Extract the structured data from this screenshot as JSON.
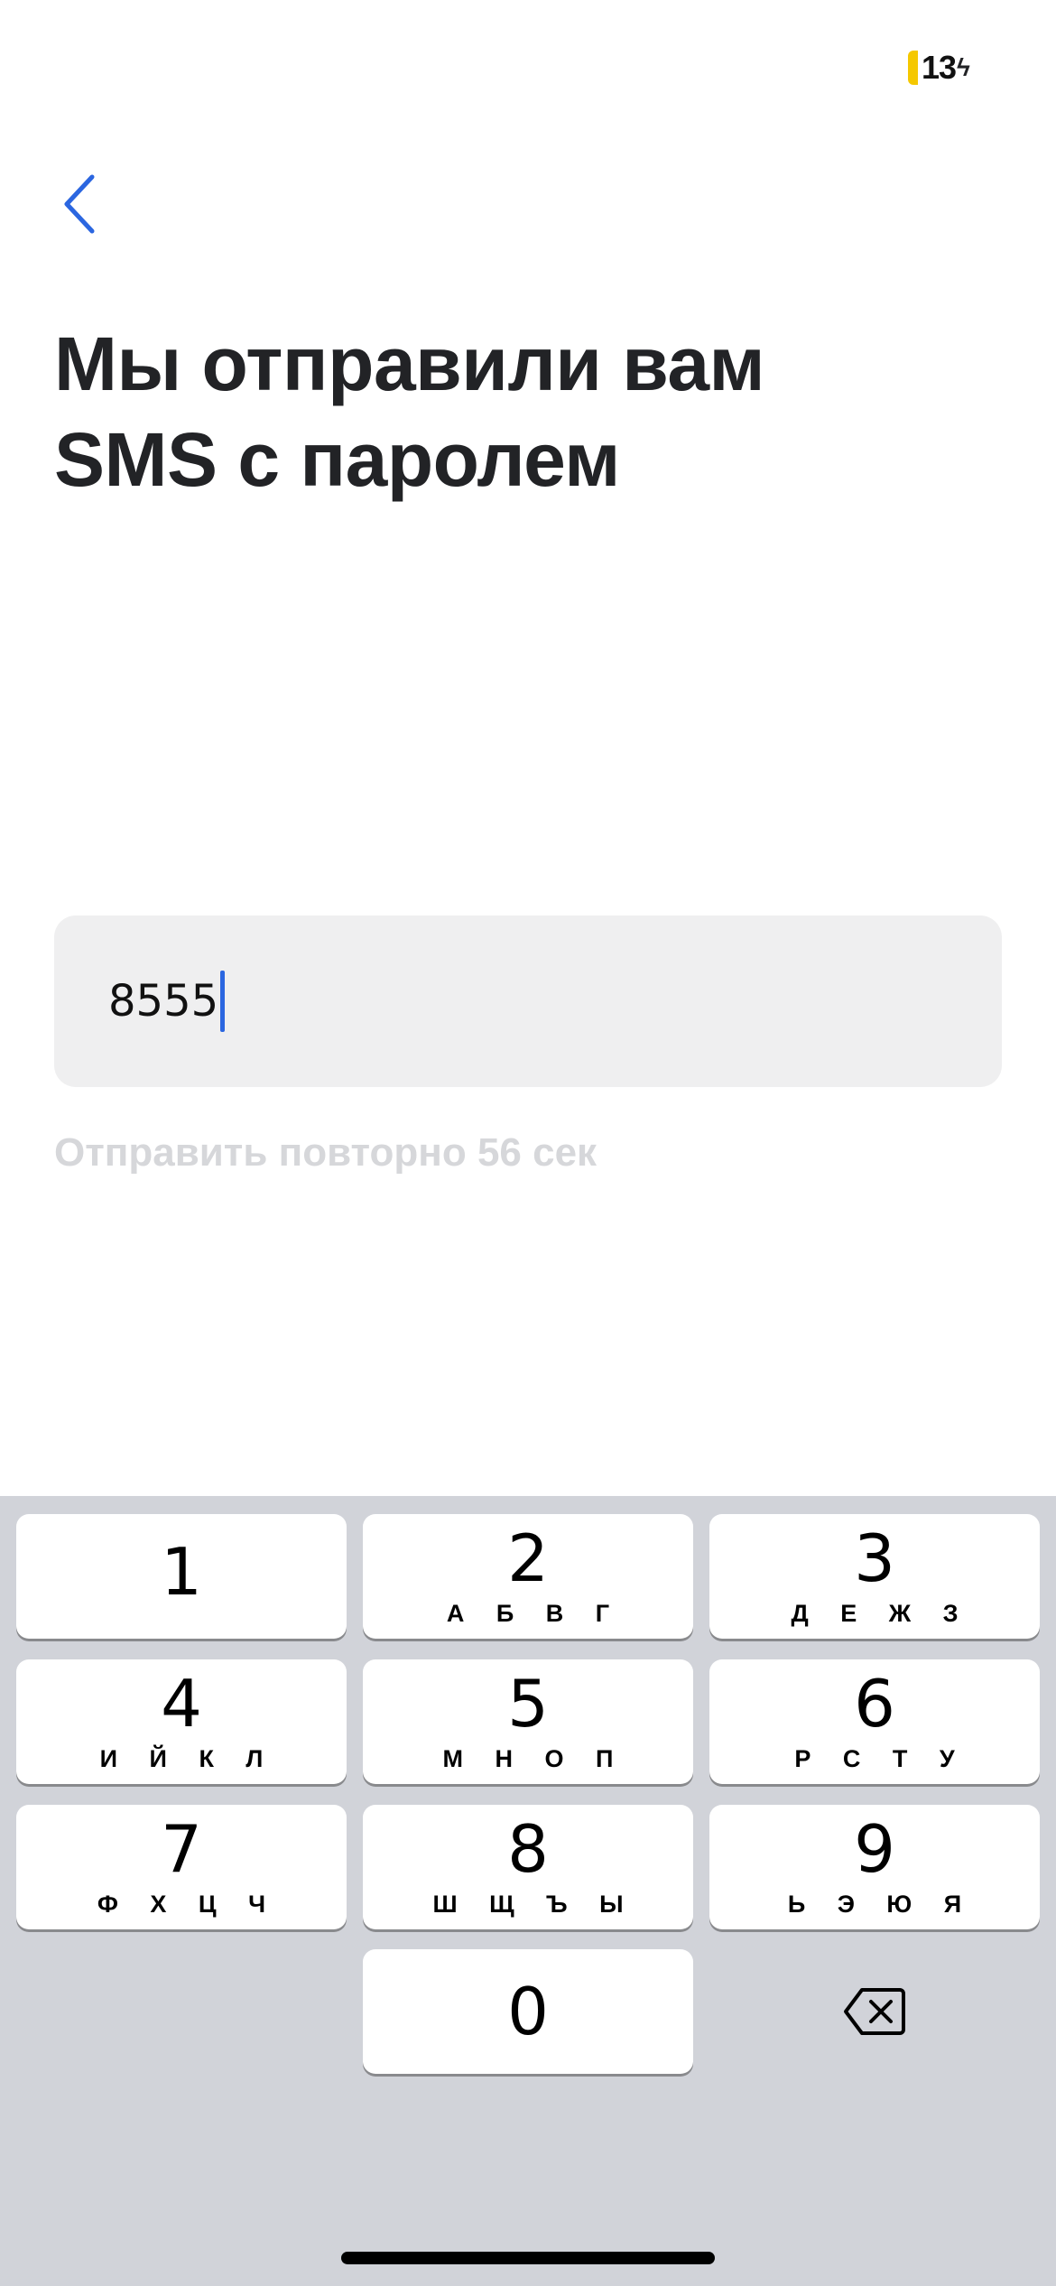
{
  "status": {
    "battery": "13"
  },
  "header": {
    "title_line1": "Мы отправили вам",
    "title_line2": "SMS с паролем"
  },
  "code_input": {
    "value": "8555"
  },
  "resend": {
    "label": "Отправить повторно 56 сек"
  },
  "keypad": {
    "keys": [
      {
        "digit": "1",
        "letters": ""
      },
      {
        "digit": "2",
        "letters": "А Б В Г"
      },
      {
        "digit": "3",
        "letters": "Д Е Ж З"
      },
      {
        "digit": "4",
        "letters": "И Й К Л"
      },
      {
        "digit": "5",
        "letters": "М Н О П"
      },
      {
        "digit": "6",
        "letters": "Р С Т У"
      },
      {
        "digit": "7",
        "letters": "Ф Х Ц Ч"
      },
      {
        "digit": "8",
        "letters": "Ш Щ Ъ Ы"
      },
      {
        "digit": "9",
        "letters": "Ь Э Ю Я"
      },
      {
        "digit": "0",
        "letters": ""
      }
    ]
  },
  "colors": {
    "accent": "#2b66e0",
    "battery": "#f5c800",
    "keyboard_bg": "#d1d3d9"
  }
}
